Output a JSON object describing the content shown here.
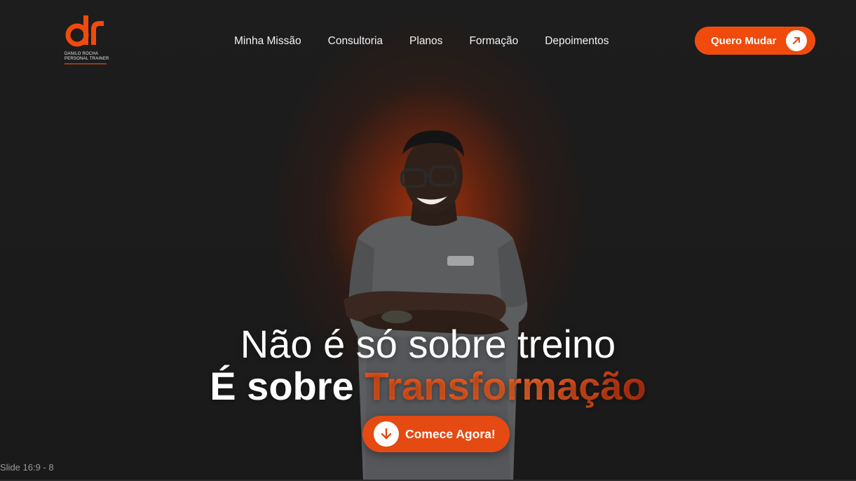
{
  "brand": {
    "logo_letters": "dr",
    "name_line1": "DANILO ROCHA",
    "name_line2": "PERSONAL TRAINER",
    "accent_color": "#f04a0c"
  },
  "nav": {
    "items": [
      {
        "label": "Minha Missão"
      },
      {
        "label": "Consultoria"
      },
      {
        "label": "Planos"
      },
      {
        "label": "Formação"
      },
      {
        "label": "Depoimentos"
      }
    ]
  },
  "header_cta": {
    "label": "Quero Mudar",
    "icon": "arrow-up-right-icon"
  },
  "hero": {
    "line1": "Não é só sobre treino",
    "line2_prefix": "É sobre ",
    "line2_accent": "Transformação",
    "cta_label": "Comece Agora!",
    "cta_icon": "arrow-down-icon"
  },
  "frame": {
    "label": "Slide 16:9 - 8"
  }
}
